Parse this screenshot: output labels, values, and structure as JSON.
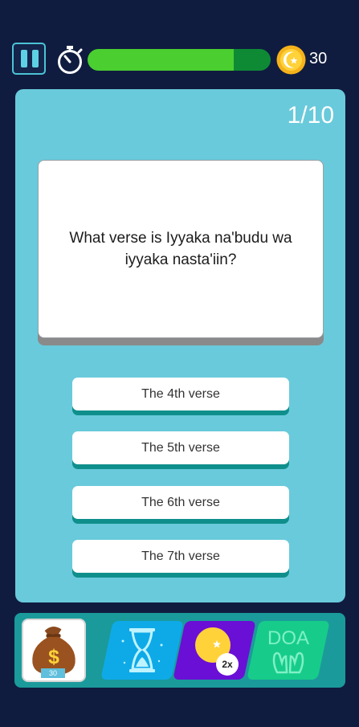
{
  "top_bar": {
    "coins": "30",
    "timer_progress": 0.8
  },
  "quiz": {
    "counter": "1/10",
    "question": "What verse is Iyyaka na'budu wa iyyaka nasta'iin?",
    "answers": [
      {
        "label": "The 4th verse"
      },
      {
        "label": "The 5th verse"
      },
      {
        "label": "The 6th verse"
      },
      {
        "label": "The 7th verse"
      }
    ]
  },
  "powerups": {
    "money_count": "30",
    "double_badge": "2x",
    "doa_label": "DOA"
  },
  "icons": [
    "pause-icon",
    "stopwatch-icon",
    "coin-icon",
    "money-bag-icon",
    "hourglass-icon",
    "crescent-coin-icon",
    "praying-hands-icon"
  ],
  "colors": {
    "background": "#101c3f",
    "panel": "#69cadb",
    "progress_fill": "#4bce30",
    "progress_track": "#0e8a35",
    "answer_shadow": "#0f8f8c",
    "hourglass_tile": "#0eaae8",
    "double_tile": "#6a0fd6",
    "doa_tile": "#17cc8a"
  }
}
